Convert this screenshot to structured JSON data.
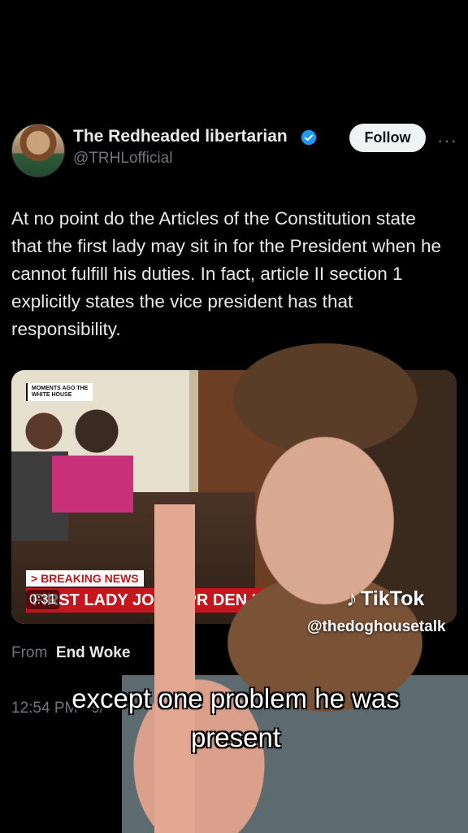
{
  "tweet": {
    "display_name": "The Redheaded libertarian",
    "handle": "@TRHLofficial",
    "follow_label": "Follow",
    "more_label": "···",
    "text": "At no point do the Articles of the Constitution state that the first lady may sit in for the President when he cannot fulfill his duties. In fact, article II section 1 explicitly states the vice president has that responsibility.",
    "source_prefix": "From",
    "source_name": "End Woke",
    "timestamp": "12:54 PM · 9/"
  },
  "media": {
    "moments_tag": "MOMENTS AGO THE WHITE HOUSE",
    "breaking_label": "> BREAKING NEWS",
    "headline": "FIRST LADY JOINS PR      DEN IN",
    "timer": "0:31"
  },
  "overlay": {
    "tiktok_brand": "TikTok",
    "tiktok_handle": "@thedoghousetalk",
    "caption": "except one problem he was present"
  },
  "colors": {
    "background": "#000000",
    "follow_button_bg": "#eff3f4",
    "verified_blue": "#1d9bf0",
    "breaking_red": "#c4161c"
  }
}
